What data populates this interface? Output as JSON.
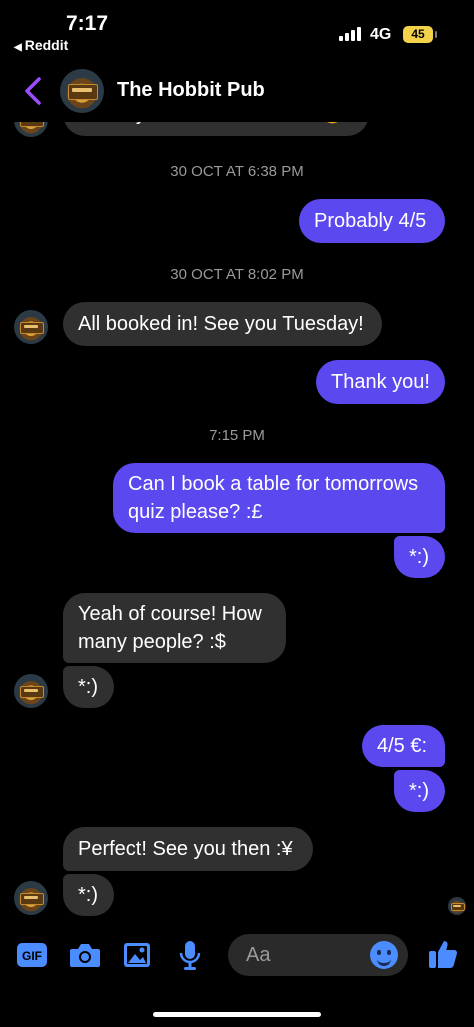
{
  "status_bar": {
    "time": "7:17",
    "back_app": "Reddit",
    "network": "4G",
    "battery": "45"
  },
  "header": {
    "title": "The Hobbit Pub"
  },
  "messages": {
    "m0": "would you like to book for? 😊",
    "t1": "30 OCT AT 6:38 PM",
    "m1": "Probably 4/5",
    "t2": "30 OCT AT 8:02 PM",
    "m2": "All booked in! See you Tuesday!",
    "m3": "Thank you!",
    "t3": "7:15 PM",
    "m4": "Can I book a table for tomorrows quiz please? :£",
    "m5": "*:)",
    "m6": "Yeah of course! How many people? :$",
    "m7": "*:)",
    "m8": "4/5 €:",
    "m9": "*:)",
    "m10": "Perfect! See you then :¥",
    "m11": "*:)"
  },
  "composer": {
    "placeholder": "Aa",
    "gif_label": "GIF"
  },
  "colors": {
    "outgoing": "#5b48ee",
    "incoming": "#303030",
    "accent": "#9b4dff",
    "icons": "#4b8cff"
  }
}
